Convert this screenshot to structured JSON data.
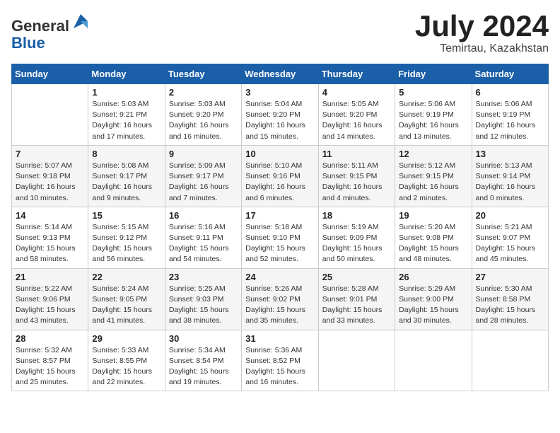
{
  "header": {
    "logo_line1": "General",
    "logo_line2": "Blue",
    "title": "July 2024",
    "location": "Temirtau, Kazakhstan"
  },
  "weekdays": [
    "Sunday",
    "Monday",
    "Tuesday",
    "Wednesday",
    "Thursday",
    "Friday",
    "Saturday"
  ],
  "weeks": [
    [
      {
        "day": null
      },
      {
        "day": "1",
        "sunrise": "Sunrise: 5:03 AM",
        "sunset": "Sunset: 9:21 PM",
        "daylight": "Daylight: 16 hours and 17 minutes."
      },
      {
        "day": "2",
        "sunrise": "Sunrise: 5:03 AM",
        "sunset": "Sunset: 9:20 PM",
        "daylight": "Daylight: 16 hours and 16 minutes."
      },
      {
        "day": "3",
        "sunrise": "Sunrise: 5:04 AM",
        "sunset": "Sunset: 9:20 PM",
        "daylight": "Daylight: 16 hours and 15 minutes."
      },
      {
        "day": "4",
        "sunrise": "Sunrise: 5:05 AM",
        "sunset": "Sunset: 9:20 PM",
        "daylight": "Daylight: 16 hours and 14 minutes."
      },
      {
        "day": "5",
        "sunrise": "Sunrise: 5:06 AM",
        "sunset": "Sunset: 9:19 PM",
        "daylight": "Daylight: 16 hours and 13 minutes."
      },
      {
        "day": "6",
        "sunrise": "Sunrise: 5:06 AM",
        "sunset": "Sunset: 9:19 PM",
        "daylight": "Daylight: 16 hours and 12 minutes."
      }
    ],
    [
      {
        "day": "7",
        "sunrise": "Sunrise: 5:07 AM",
        "sunset": "Sunset: 9:18 PM",
        "daylight": "Daylight: 16 hours and 10 minutes."
      },
      {
        "day": "8",
        "sunrise": "Sunrise: 5:08 AM",
        "sunset": "Sunset: 9:17 PM",
        "daylight": "Daylight: 16 hours and 9 minutes."
      },
      {
        "day": "9",
        "sunrise": "Sunrise: 5:09 AM",
        "sunset": "Sunset: 9:17 PM",
        "daylight": "Daylight: 16 hours and 7 minutes."
      },
      {
        "day": "10",
        "sunrise": "Sunrise: 5:10 AM",
        "sunset": "Sunset: 9:16 PM",
        "daylight": "Daylight: 16 hours and 6 minutes."
      },
      {
        "day": "11",
        "sunrise": "Sunrise: 5:11 AM",
        "sunset": "Sunset: 9:15 PM",
        "daylight": "Daylight: 16 hours and 4 minutes."
      },
      {
        "day": "12",
        "sunrise": "Sunrise: 5:12 AM",
        "sunset": "Sunset: 9:15 PM",
        "daylight": "Daylight: 16 hours and 2 minutes."
      },
      {
        "day": "13",
        "sunrise": "Sunrise: 5:13 AM",
        "sunset": "Sunset: 9:14 PM",
        "daylight": "Daylight: 16 hours and 0 minutes."
      }
    ],
    [
      {
        "day": "14",
        "sunrise": "Sunrise: 5:14 AM",
        "sunset": "Sunset: 9:13 PM",
        "daylight": "Daylight: 15 hours and 58 minutes."
      },
      {
        "day": "15",
        "sunrise": "Sunrise: 5:15 AM",
        "sunset": "Sunset: 9:12 PM",
        "daylight": "Daylight: 15 hours and 56 minutes."
      },
      {
        "day": "16",
        "sunrise": "Sunrise: 5:16 AM",
        "sunset": "Sunset: 9:11 PM",
        "daylight": "Daylight: 15 hours and 54 minutes."
      },
      {
        "day": "17",
        "sunrise": "Sunrise: 5:18 AM",
        "sunset": "Sunset: 9:10 PM",
        "daylight": "Daylight: 15 hours and 52 minutes."
      },
      {
        "day": "18",
        "sunrise": "Sunrise: 5:19 AM",
        "sunset": "Sunset: 9:09 PM",
        "daylight": "Daylight: 15 hours and 50 minutes."
      },
      {
        "day": "19",
        "sunrise": "Sunrise: 5:20 AM",
        "sunset": "Sunset: 9:08 PM",
        "daylight": "Daylight: 15 hours and 48 minutes."
      },
      {
        "day": "20",
        "sunrise": "Sunrise: 5:21 AM",
        "sunset": "Sunset: 9:07 PM",
        "daylight": "Daylight: 15 hours and 45 minutes."
      }
    ],
    [
      {
        "day": "21",
        "sunrise": "Sunrise: 5:22 AM",
        "sunset": "Sunset: 9:06 PM",
        "daylight": "Daylight: 15 hours and 43 minutes."
      },
      {
        "day": "22",
        "sunrise": "Sunrise: 5:24 AM",
        "sunset": "Sunset: 9:05 PM",
        "daylight": "Daylight: 15 hours and 41 minutes."
      },
      {
        "day": "23",
        "sunrise": "Sunrise: 5:25 AM",
        "sunset": "Sunset: 9:03 PM",
        "daylight": "Daylight: 15 hours and 38 minutes."
      },
      {
        "day": "24",
        "sunrise": "Sunrise: 5:26 AM",
        "sunset": "Sunset: 9:02 PM",
        "daylight": "Daylight: 15 hours and 35 minutes."
      },
      {
        "day": "25",
        "sunrise": "Sunrise: 5:28 AM",
        "sunset": "Sunset: 9:01 PM",
        "daylight": "Daylight: 15 hours and 33 minutes."
      },
      {
        "day": "26",
        "sunrise": "Sunrise: 5:29 AM",
        "sunset": "Sunset: 9:00 PM",
        "daylight": "Daylight: 15 hours and 30 minutes."
      },
      {
        "day": "27",
        "sunrise": "Sunrise: 5:30 AM",
        "sunset": "Sunset: 8:58 PM",
        "daylight": "Daylight: 15 hours and 28 minutes."
      }
    ],
    [
      {
        "day": "28",
        "sunrise": "Sunrise: 5:32 AM",
        "sunset": "Sunset: 8:57 PM",
        "daylight": "Daylight: 15 hours and 25 minutes."
      },
      {
        "day": "29",
        "sunrise": "Sunrise: 5:33 AM",
        "sunset": "Sunset: 8:55 PM",
        "daylight": "Daylight: 15 hours and 22 minutes."
      },
      {
        "day": "30",
        "sunrise": "Sunrise: 5:34 AM",
        "sunset": "Sunset: 8:54 PM",
        "daylight": "Daylight: 15 hours and 19 minutes."
      },
      {
        "day": "31",
        "sunrise": "Sunrise: 5:36 AM",
        "sunset": "Sunset: 8:52 PM",
        "daylight": "Daylight: 15 hours and 16 minutes."
      },
      {
        "day": null
      },
      {
        "day": null
      },
      {
        "day": null
      }
    ]
  ]
}
